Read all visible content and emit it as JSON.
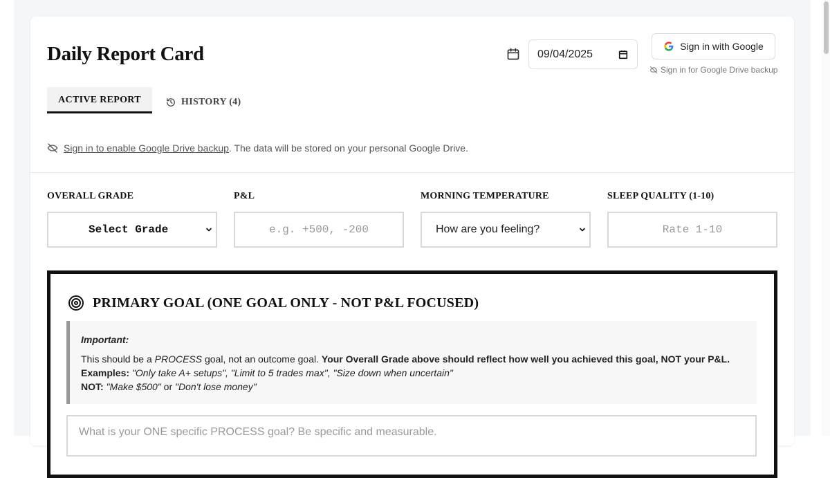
{
  "header": {
    "title": "Daily Report Card",
    "date_value": "09/04/2025",
    "google_button_label": "Sign in with Google",
    "google_hint": "Sign in for Google Drive backup"
  },
  "tabs": [
    {
      "label": "ACTIVE REPORT",
      "active": true
    },
    {
      "label": "HISTORY (4)",
      "active": false
    }
  ],
  "drive_notice": {
    "link_text": "Sign in to enable Google Drive backup",
    "rest_text": ". The data will be stored on your personal Google Drive."
  },
  "fields": {
    "overall_grade": {
      "label": "OVERALL GRADE",
      "value": "Select Grade"
    },
    "pnl": {
      "label": "P&L",
      "placeholder": "e.g. +500, -200"
    },
    "morning_temperature": {
      "label": "MORNING TEMPERATURE",
      "value": "How are you feeling?"
    },
    "sleep_quality": {
      "label": "SLEEP QUALITY (1-10)",
      "placeholder": "Rate 1-10"
    }
  },
  "primary_goal": {
    "title": "PRIMARY GOAL (ONE GOAL ONLY - NOT P&L FOCUSED)",
    "important_label": "Important:",
    "line1_a": "This should be a ",
    "line1_b": "PROCESS",
    "line1_c": " goal, not an outcome goal. ",
    "line1_bold": "Your Overall Grade above should reflect how well you achieved this goal, NOT your P&L.",
    "examples_label": "Examples:",
    "examples_text": " \"Only take A+ setups\", \"Limit to 5 trades max\", \"Size down when uncertain\"",
    "not_label": "NOT:",
    "not_a": " \"Make $500\"",
    "not_or": " or ",
    "not_b": "\"Don't lose money\"",
    "input_placeholder": "What is your ONE specific PROCESS goal? Be specific and measurable."
  },
  "colors": {
    "accent": "#111111",
    "page_background": "#f5f6f8",
    "important_border": "#999999"
  },
  "icons": [
    "calendar-icon",
    "google-logo-icon",
    "cloud-off-icon",
    "history-icon",
    "eye-off-icon",
    "target-icon",
    "chevron-down-icon"
  ]
}
